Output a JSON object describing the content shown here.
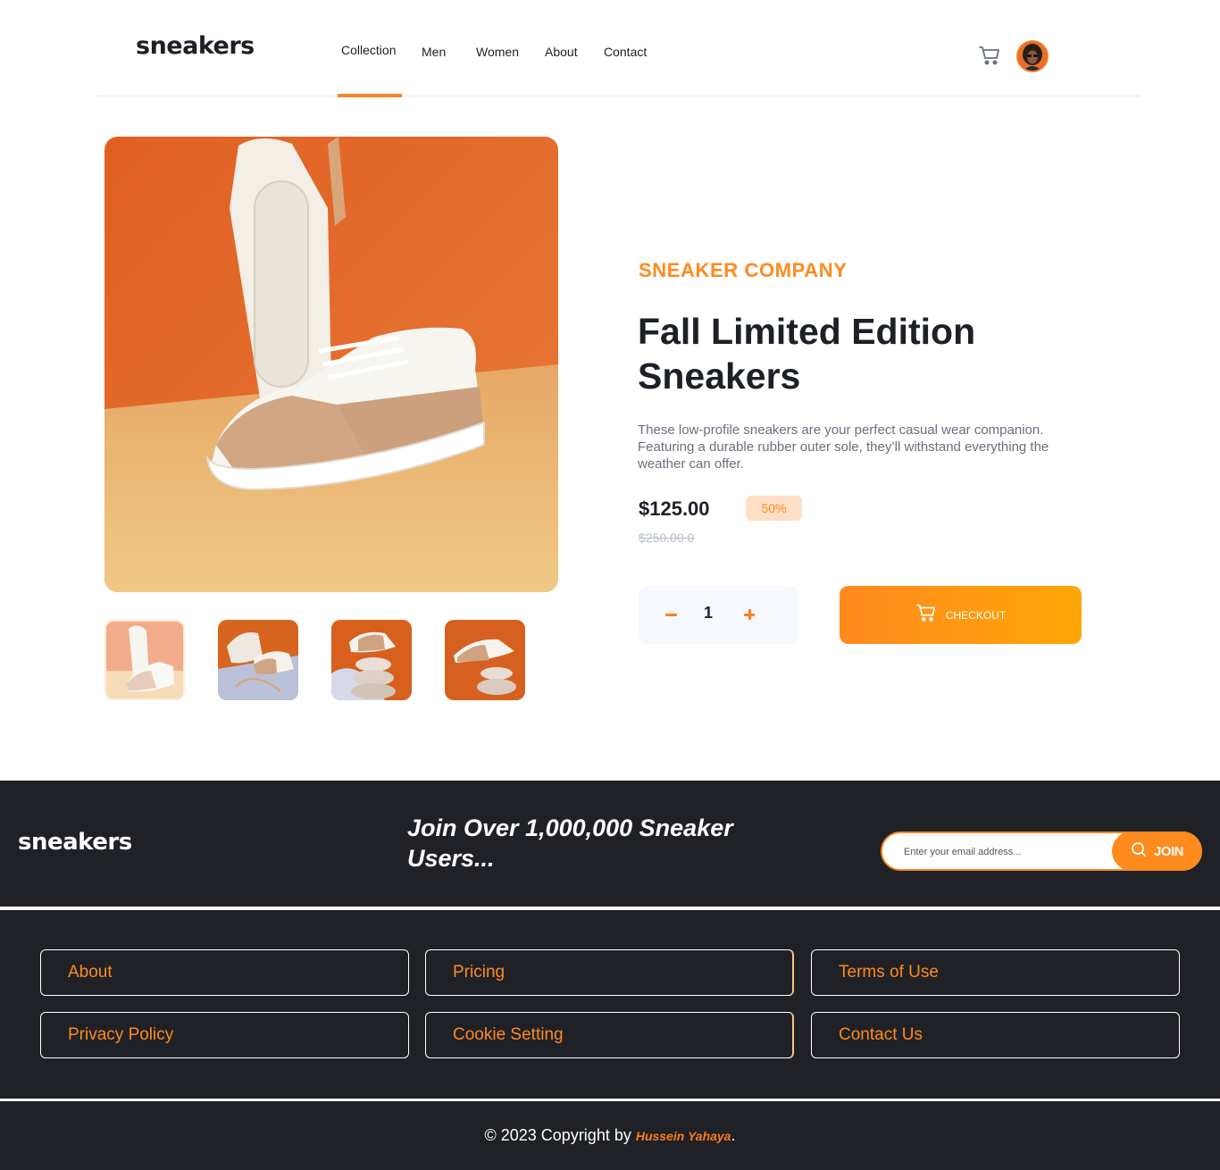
{
  "header": {
    "logo": "sneakers",
    "nav": [
      {
        "label": "Collection",
        "active": true
      },
      {
        "label": "Men"
      },
      {
        "label": "Women"
      },
      {
        "label": "About"
      },
      {
        "label": "Contact"
      }
    ],
    "cart_icon": "cart-icon",
    "avatar_icon": "user-avatar"
  },
  "product": {
    "company": "SNEAKER COMPANY",
    "title": "Fall Limited Edition Sneakers",
    "description": "These low-profile sneakers are your perfect casual wear companion. Featuring a durable rubber outer sole, they’ll withstand everything the weather can offer.",
    "price": "$125.00",
    "discount": "50%",
    "old_price": "$250.00 0",
    "quantity": "1",
    "checkout_label": "CHECKOUT",
    "thumbnails_count": 4,
    "active_thumbnail": 1
  },
  "newsletter": {
    "logo": "sneakers",
    "heading": "Join Over 1,000,000 Sneaker Users...",
    "email_placeholder": "Enter your email address...",
    "join_label": "JOIN"
  },
  "footer": {
    "links": [
      "About",
      "Pricing",
      "Terms of Use",
      "Privacy Policy",
      "Cookie Setting",
      "Contact Us"
    ],
    "copyright_prefix": "© 2023 Copyright by",
    "author": "Hussein Yahaya",
    "copyright_suffix": "."
  },
  "colors": {
    "accent": "#ff8a1e",
    "dark": "#1f2126",
    "text": "#1d2026",
    "muted": "#69707d",
    "discount_bg": "#ffdfc6"
  }
}
